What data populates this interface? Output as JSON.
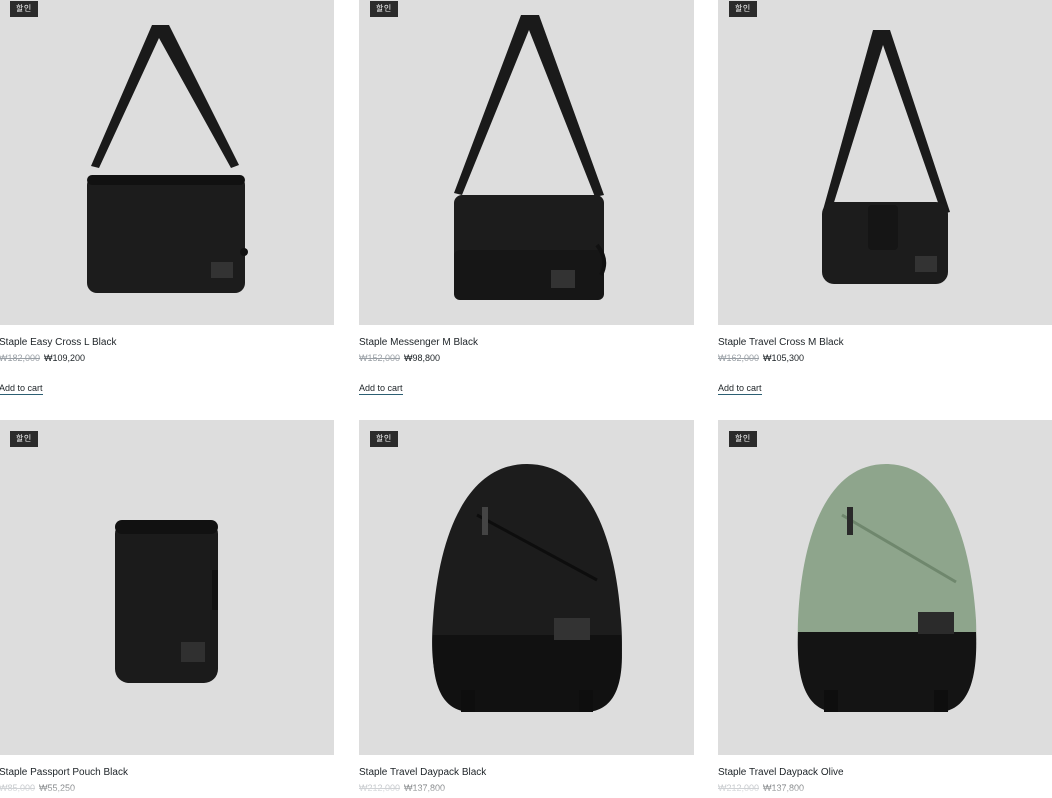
{
  "products": [
    {
      "title": "Staple Easy Cross L Black",
      "badge": "할인",
      "old_price": "₩182,000",
      "new_price": "₩109,200",
      "cart": "Add to cart",
      "image": "black-crossbody-bag"
    },
    {
      "title": "Staple Messenger M Black",
      "badge": "할인",
      "old_price": "₩152,000",
      "new_price": "₩98,800",
      "cart": "Add to cart",
      "image": "black-messenger-bag"
    },
    {
      "title": "Staple Travel Cross M Black",
      "badge": "할인",
      "old_price": "₩162,000",
      "new_price": "₩105,300",
      "cart": "Add to cart",
      "image": "black-travel-cross-bag"
    },
    {
      "title": "Staple Passport Pouch Black",
      "badge": "할인",
      "old_price": "₩85,000",
      "new_price": "₩55,250",
      "image": "black-passport-pouch"
    },
    {
      "title": "Staple Travel Daypack Black",
      "badge": "할인",
      "old_price": "₩212,000",
      "new_price": "₩137,800",
      "image": "black-daypack"
    },
    {
      "title": "Staple Travel Daypack Olive",
      "badge": "할인",
      "old_price": "₩212,000",
      "new_price": "₩137,800",
      "image": "olive-daypack"
    }
  ],
  "colors": {
    "image_bg": "#dddddd",
    "badge_bg": "#2b2b2b",
    "olive": "#8ea58c",
    "bag_black": "#1a1a1a"
  }
}
